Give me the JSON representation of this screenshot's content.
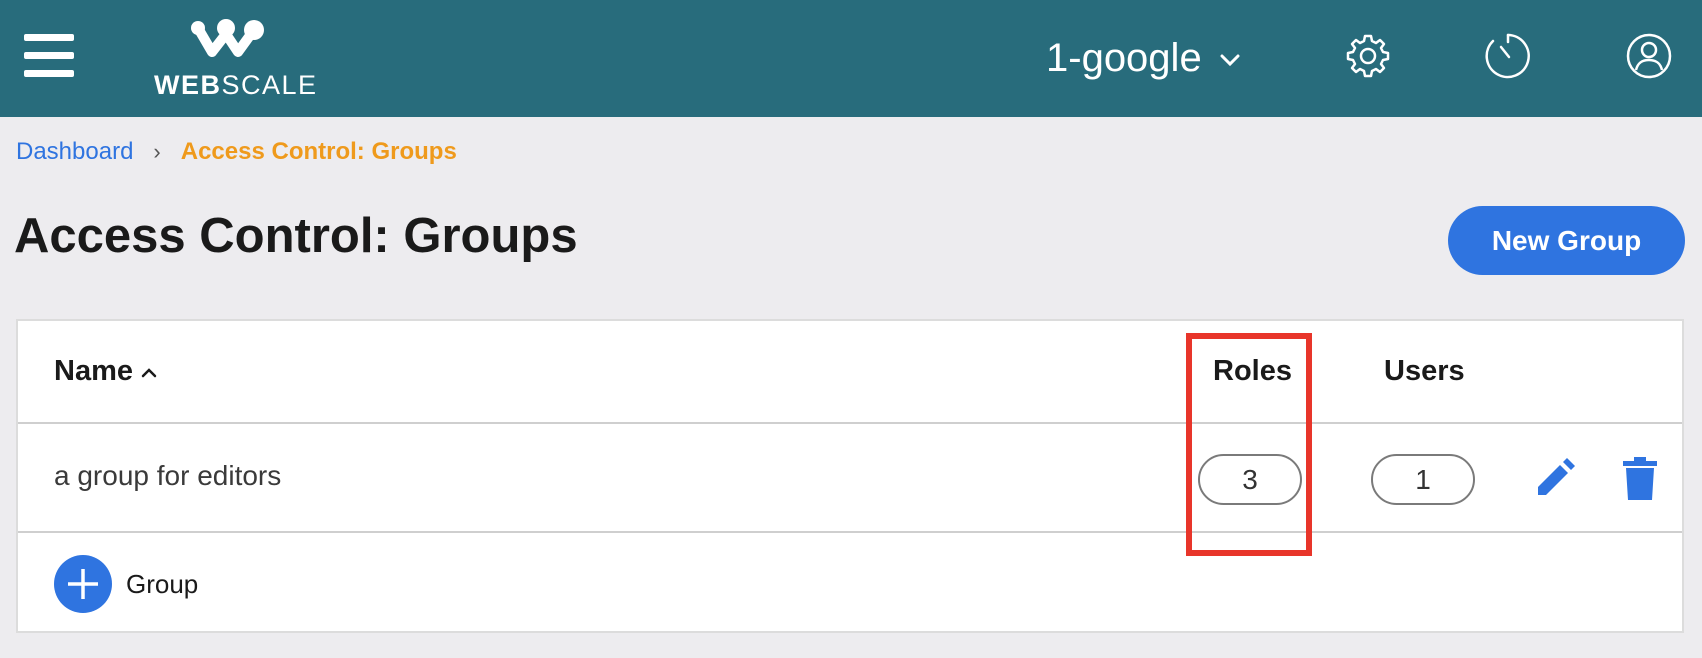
{
  "topbar": {
    "logo_text_bold": "WEB",
    "logo_text_light": "SCALE",
    "account_name": "1-google",
    "icons": [
      "hamburger-menu-icon",
      "chevron-down-icon",
      "gear-icon",
      "timer-icon",
      "user-icon"
    ]
  },
  "breadcrumb": {
    "items": [
      "Dashboard",
      "Access Control: Groups"
    ],
    "separator": "›"
  },
  "page": {
    "title": "Access Control: Groups",
    "new_button": "New Group"
  },
  "table": {
    "columns": {
      "name": "Name",
      "roles": "Roles",
      "users": "Users"
    },
    "rows": [
      {
        "name": "a group for editors",
        "roles": "3",
        "users": "1"
      }
    ],
    "add_label": "Group"
  },
  "colors": {
    "topbar": "#286c7c",
    "accent": "#2f74e0",
    "breadcrumb_current": "#ef9a1c",
    "highlight": "#e8352a",
    "background": "#edecef"
  }
}
